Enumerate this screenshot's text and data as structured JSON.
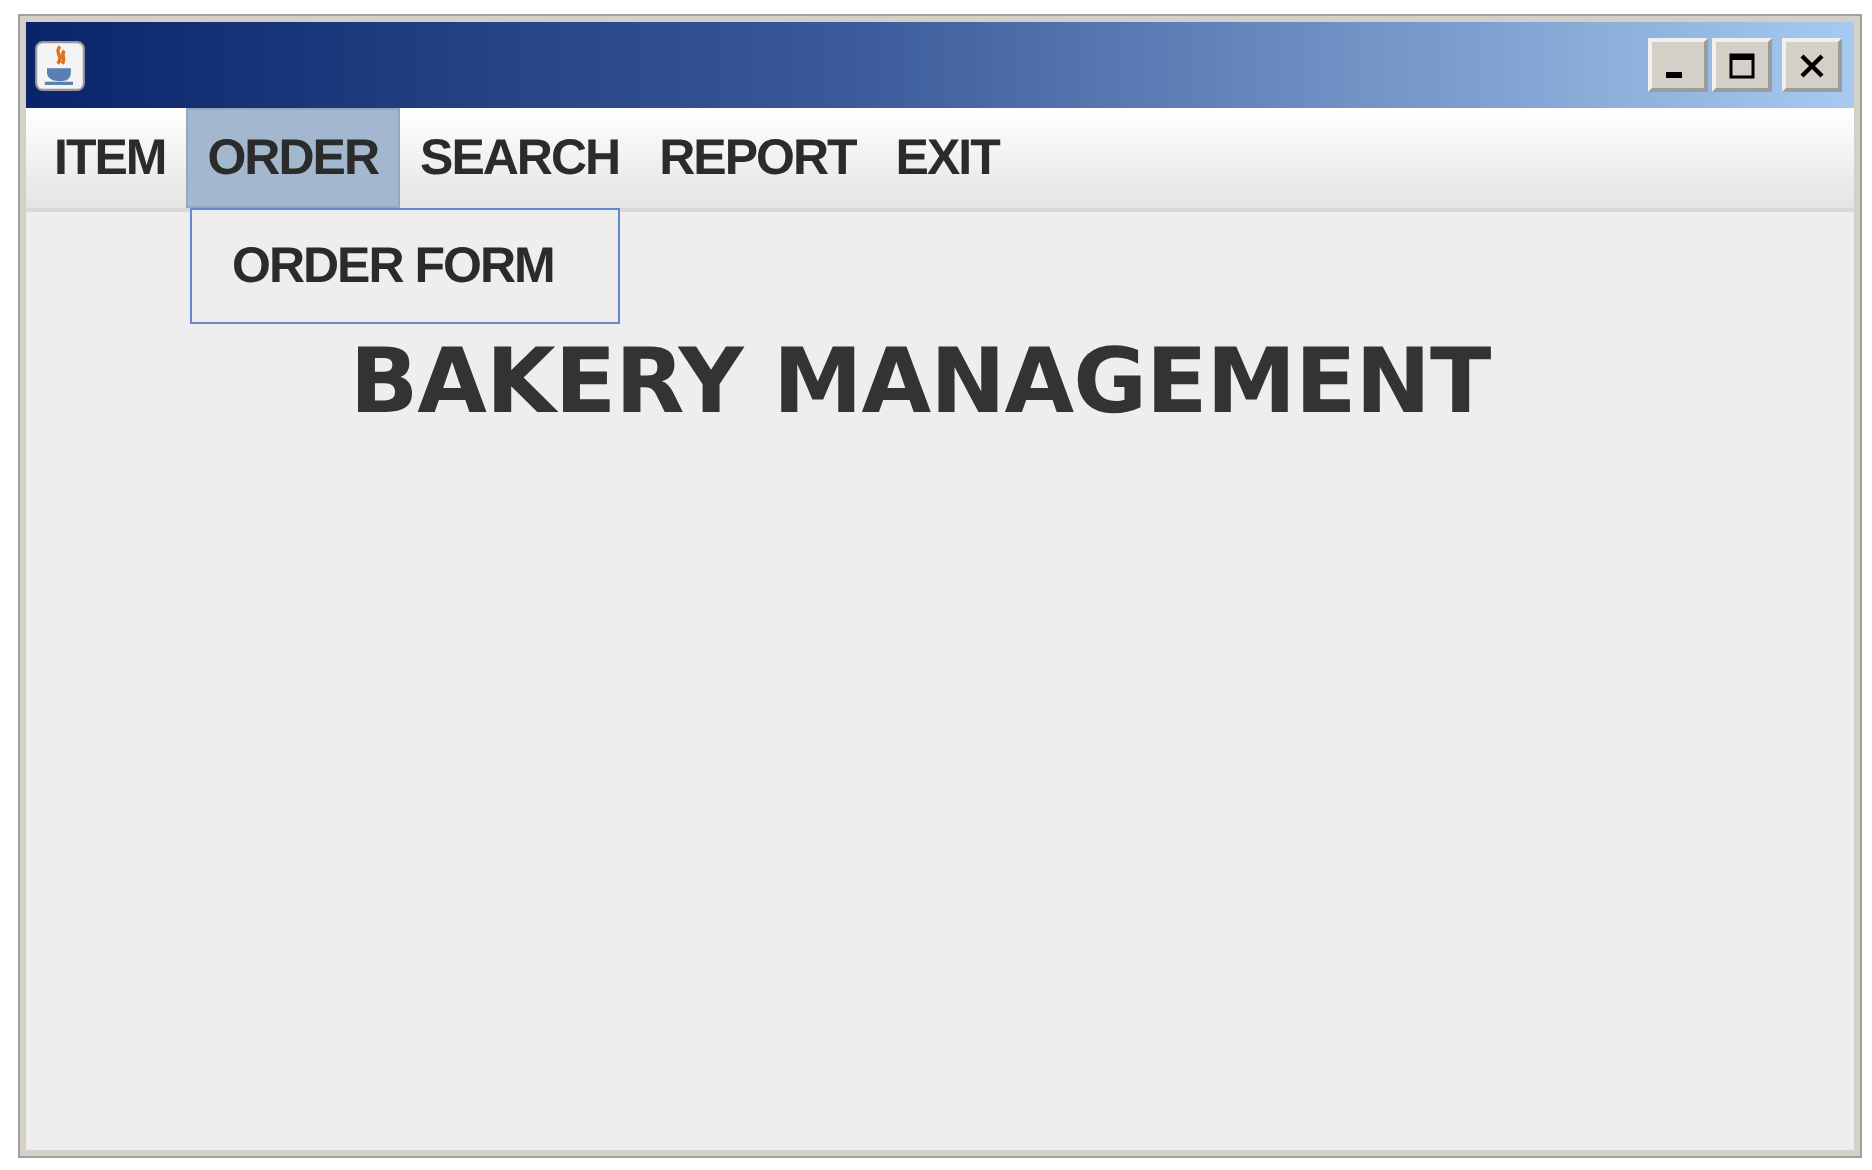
{
  "menu_bar": {
    "menus": [
      {
        "label": "ITEM",
        "selected": false
      },
      {
        "label": "ORDER",
        "selected": true
      },
      {
        "label": "SEARCH",
        "selected": false
      },
      {
        "label": "REPORT",
        "selected": false
      },
      {
        "label": "EXIT",
        "selected": false
      }
    ]
  },
  "open_menu": {
    "items": [
      {
        "label": "ORDER FORM"
      }
    ]
  },
  "heading": "BAKERY MANAGEMENT"
}
